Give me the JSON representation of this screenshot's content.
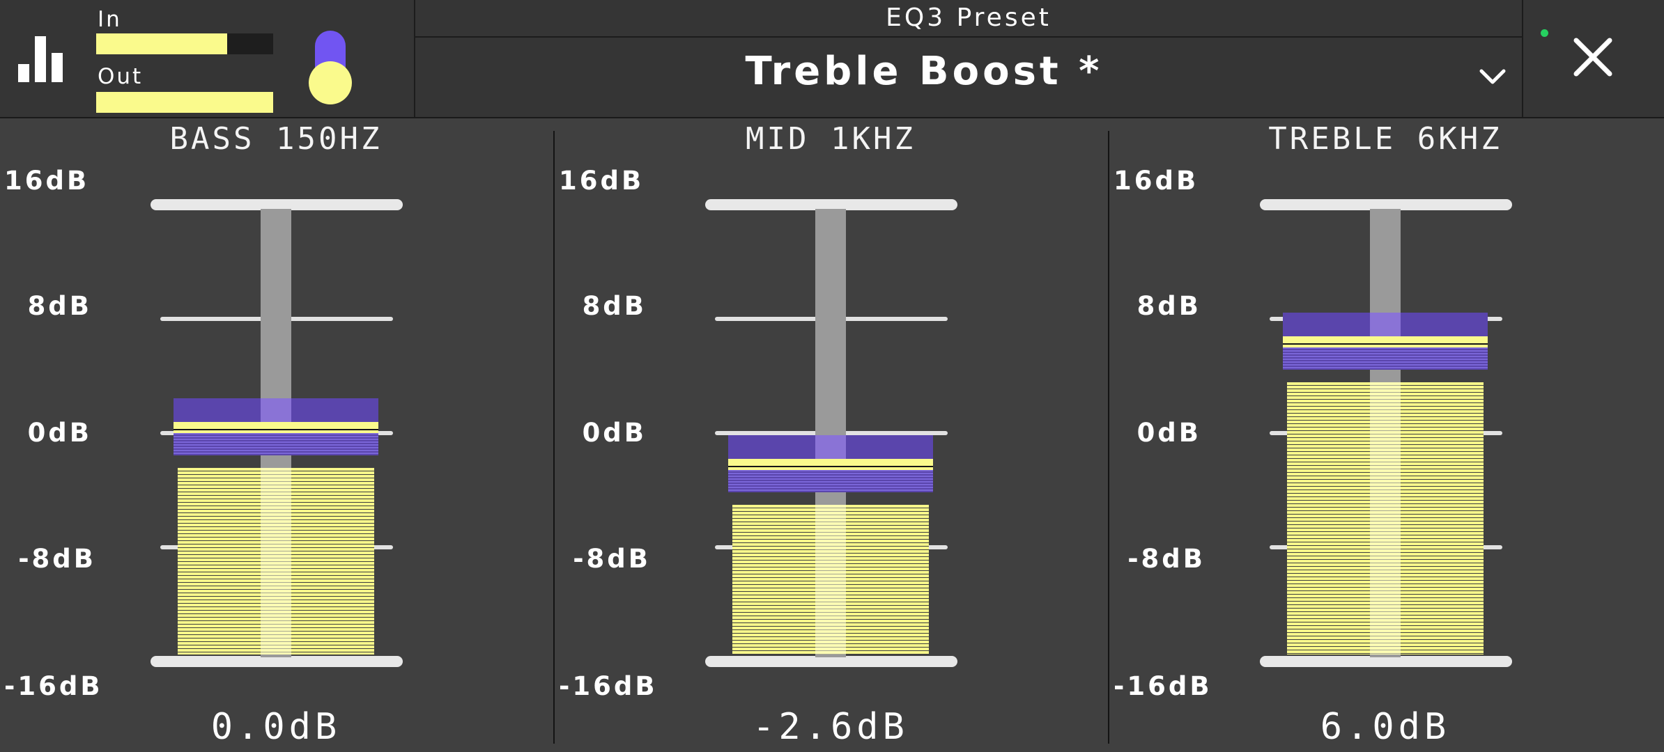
{
  "header": {
    "in_label": "In",
    "out_label": "Out",
    "in_level": 0.74,
    "out_level": 1.0,
    "preset_label": "EQ3 Preset",
    "preset_name": "Treble Boost *",
    "icons": {
      "meter": "bar-chart-icon",
      "dropdown": "chevron-down-icon",
      "close": "close-icon"
    },
    "status_color": "#26d060"
  },
  "colors": {
    "accent": "#7155f2",
    "level": "#fafa8c",
    "background": "#404040"
  },
  "scale": {
    "labels": [
      "16dB",
      "8dB",
      "0dB",
      "-8dB",
      "-16dB"
    ],
    "min": -16,
    "max": 16
  },
  "bands": [
    {
      "title": "BASS 150HZ",
      "gain_db": 0.0,
      "value_text": "0.0dB"
    },
    {
      "title": "MID 1KHZ",
      "gain_db": -2.6,
      "value_text": "-2.6dB"
    },
    {
      "title": "TREBLE 6KHZ",
      "gain_db": 6.0,
      "value_text": "6.0dB"
    }
  ]
}
